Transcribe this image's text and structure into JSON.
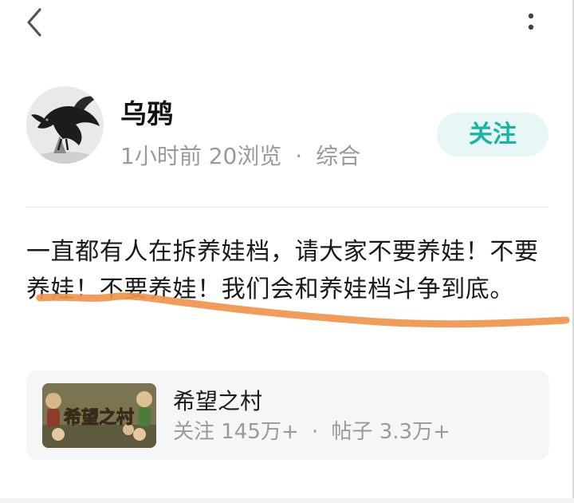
{
  "nav": {
    "back_icon": "chevron-left-icon",
    "more_icon": "more-vertical-icon"
  },
  "author": {
    "name": "乌鸦",
    "avatar_icon": "crow-avatar",
    "time": "1小时前",
    "views": "20浏览",
    "separator": "·",
    "category": "综合"
  },
  "follow_label": "关注",
  "post": {
    "text": "一直都有人在拆养娃档，请大家不要养娃！不要养娃！不要养娃！我们会和养娃档斗争到底。"
  },
  "topic": {
    "name": "希望之村",
    "thumb_title": "希望之村",
    "followers": "关注 145万+",
    "separator": "·",
    "posts": "帖子 3.3万+"
  },
  "colors": {
    "accent": "#17b3a6",
    "follow_bg": "#e6f7f6",
    "secondary_text": "#9a9a9a",
    "card_bg": "#f5f6f8",
    "annotation_stroke": "#f0944c"
  }
}
